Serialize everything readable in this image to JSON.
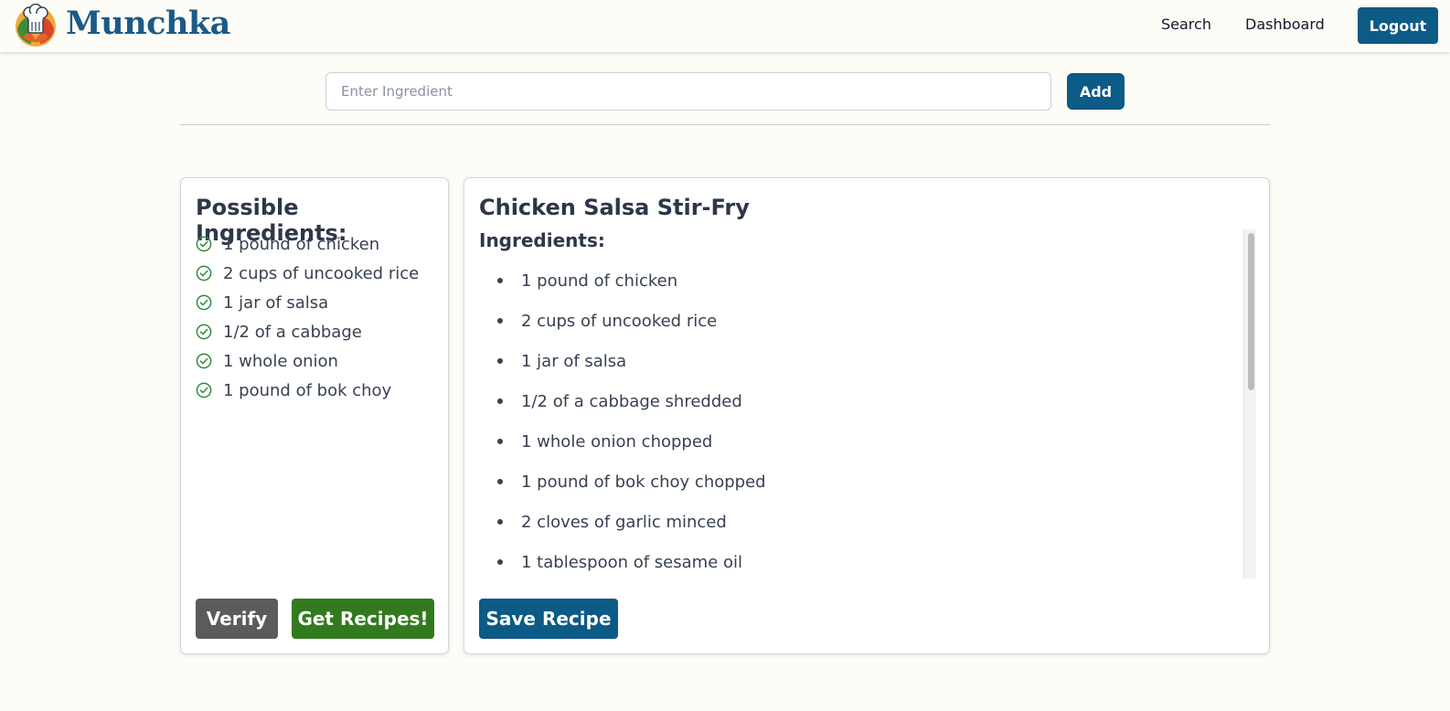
{
  "header": {
    "brand": "Munchka",
    "logo_icon": "chef-hat-logo-icon",
    "nav": {
      "search": "Search",
      "dashboard": "Dashboard"
    },
    "logout_label": "Logout"
  },
  "ingredient_entry": {
    "placeholder": "Enter Ingredient",
    "value": "",
    "add_label": "Add"
  },
  "possible_ingredients": {
    "title": "Possible Ingredients:",
    "item_icon": "check-circle-icon",
    "items": [
      "1 pound of chicken",
      "2 cups of uncooked rice",
      "1 jar of salsa",
      "1/2 of a cabbage",
      "1 whole onion",
      "1 pound of bok choy"
    ],
    "verify_label": "Verify",
    "get_recipes_label": "Get Recipes!"
  },
  "recipe": {
    "title": "Chicken Salsa Stir-Fry",
    "ingredients_heading": "Ingredients:",
    "ingredients": [
      "1 pound of chicken",
      "2 cups of uncooked rice",
      "1 jar of salsa",
      "1/2 of a cabbage shredded",
      "1 whole onion chopped",
      "1 pound of bok choy chopped",
      "2 cloves of garlic minced",
      "1 tablespoon of sesame oil"
    ],
    "save_label": "Save Recipe"
  },
  "colors": {
    "primary": "#0c5a86",
    "success": "#317a1e",
    "neutral_button": "#5b5b5b",
    "check_icon": "#2f8a3c",
    "page_background": "#fdfcf7"
  }
}
